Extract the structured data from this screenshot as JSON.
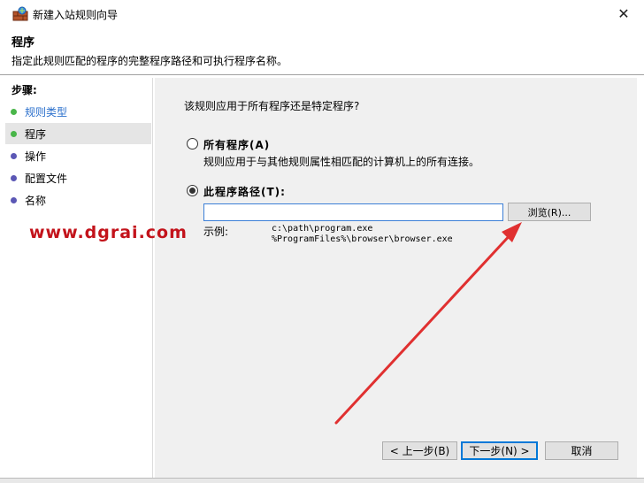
{
  "window": {
    "title": "新建入站规则向导",
    "close_label": "✕"
  },
  "header": {
    "title": "程序",
    "description": "指定此规则匹配的程序的完整程序路径和可执行程序名称。"
  },
  "sidebar": {
    "steps_title": "步骤:",
    "items": [
      {
        "label": "规则类型",
        "state": "done"
      },
      {
        "label": "程序",
        "state": "current"
      },
      {
        "label": "操作",
        "state": "todo"
      },
      {
        "label": "配置文件",
        "state": "todo"
      },
      {
        "label": "名称",
        "state": "todo"
      }
    ]
  },
  "main": {
    "question": "该规则应用于所有程序还是特定程序?",
    "option_all": {
      "label": "所有程序(A)",
      "description": "规则应用于与其他规则属性相匹配的计算机上的所有连接。",
      "checked": false
    },
    "option_path": {
      "label": "此程序路径(T):",
      "checked": true,
      "input_value": ""
    },
    "browse_label": "浏览(R)...",
    "example_label": "示例:",
    "example_lines": [
      "c:\\path\\program.exe",
      "%ProgramFiles%\\browser\\browser.exe"
    ]
  },
  "footer": {
    "back_label": "< 上一步(B)",
    "next_label": "下一步(N) >",
    "cancel_label": "取消"
  },
  "watermark": "www.dgrai.com",
  "colors": {
    "done_dot": "#49b649",
    "todo_dot": "#5b57b5",
    "link_blue": "#2a6fcc",
    "arrow_red": "#e03030",
    "watermark_red": "#c3131b"
  }
}
